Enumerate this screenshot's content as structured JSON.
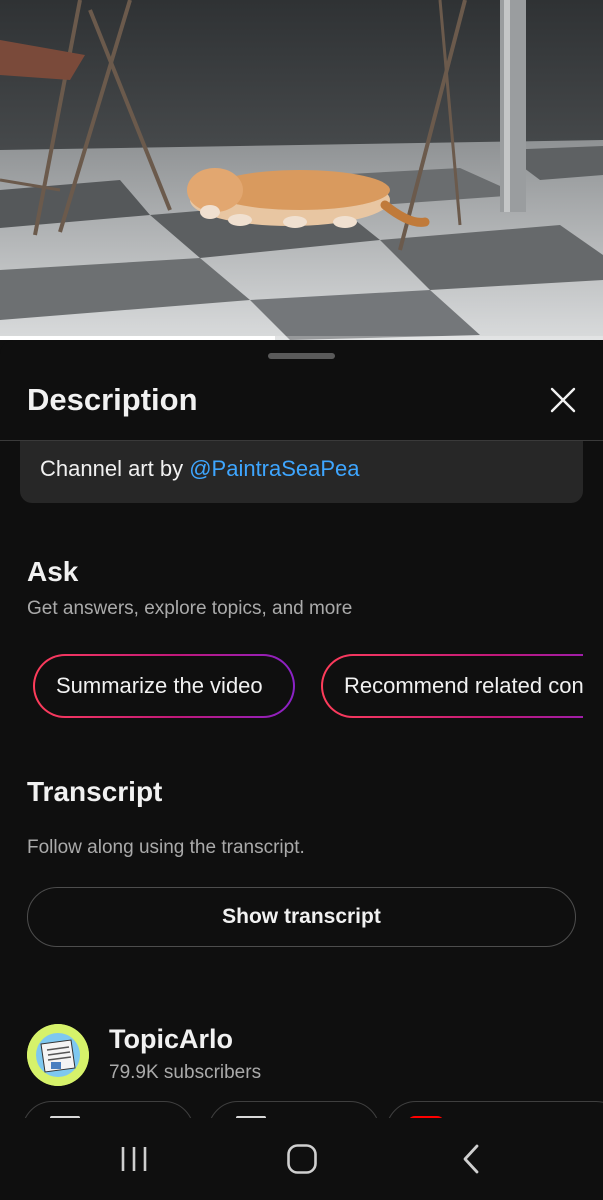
{
  "video": {
    "progress_fraction": 0.456
  },
  "sheet": {
    "title": "Description",
    "close_icon": "close-icon"
  },
  "channel_art": {
    "prefix": "Channel art by ",
    "handle": "@PaintraSeaPea",
    "link_color": "#3ea6ff"
  },
  "ask": {
    "title": "Ask",
    "subtitle": "Get answers, explore topics, and more",
    "chips": [
      {
        "label": "Summarize the video"
      },
      {
        "label": "Recommend related content"
      }
    ],
    "gradient_colors": [
      "#ff3d5a",
      "#c0187a",
      "#8a22c8"
    ]
  },
  "transcript": {
    "title": "Transcript",
    "subtitle": "Follow along using the transcript.",
    "button_label": "Show transcript"
  },
  "channel": {
    "name": "TopicArlo",
    "subscribers": "79.9K subscribers",
    "avatar_icon": "newspaper-avatar"
  },
  "bottom_pills": [
    {
      "icon": "videos-icon"
    },
    {
      "icon": "about-icon"
    },
    {
      "icon": "youtube-icon",
      "color": "#ff0000"
    }
  ],
  "nav": {
    "recents_icon": "recent-apps-icon",
    "home_icon": "home-icon",
    "back_icon": "back-icon"
  },
  "colors": {
    "background": "#0f0f0f",
    "card": "#272727",
    "secondary_text": "#aaaaaa"
  }
}
